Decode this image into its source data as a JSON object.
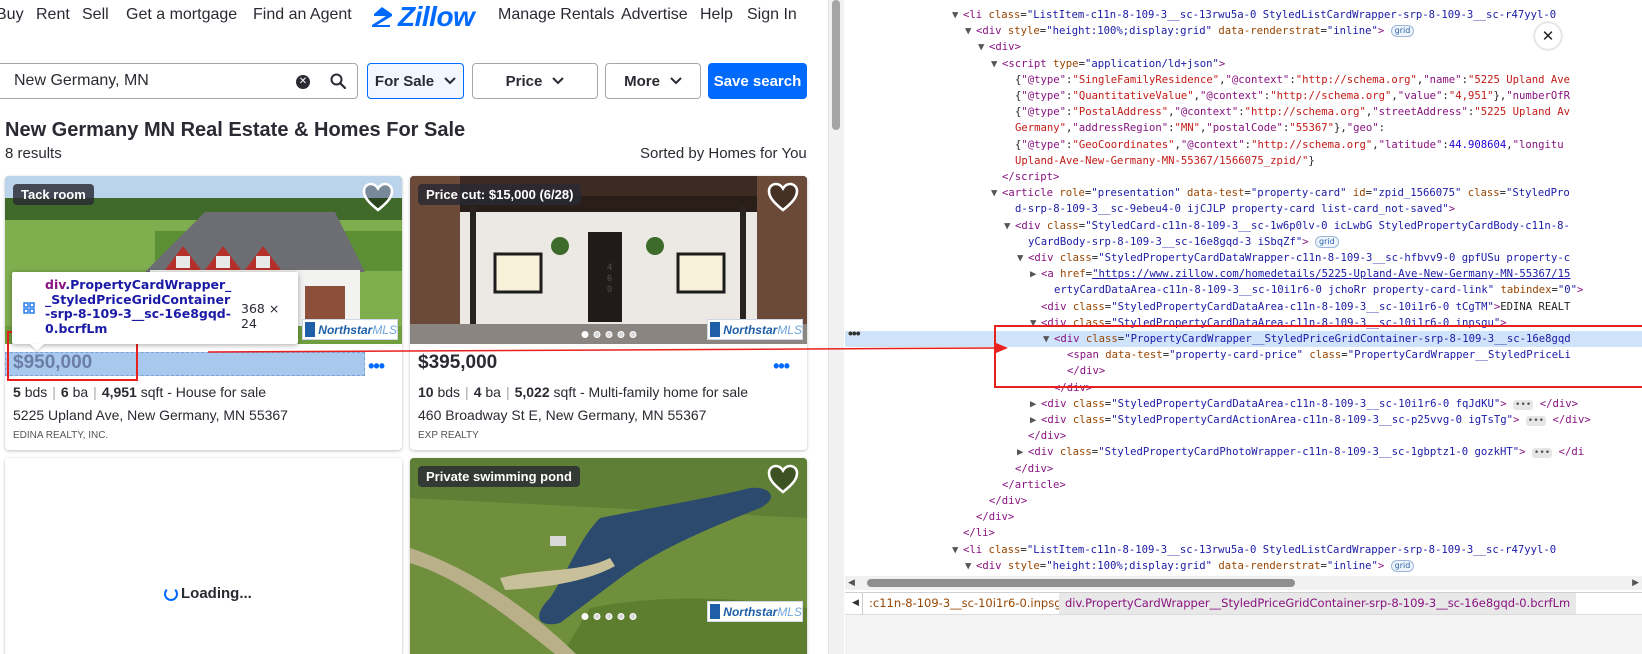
{
  "nav": {
    "buy": "Buy",
    "rent": "Rent",
    "sell": "Sell",
    "mortgage": "Get a mortgage",
    "agent": "Find an Agent",
    "logo_text": "Zillow",
    "manage_rentals": "Manage Rentals",
    "advertise": "Advertise",
    "help": "Help",
    "sign_in": "Sign In"
  },
  "search": {
    "value": "New Germany, MN",
    "clear_glyph": "✕"
  },
  "filters": {
    "for_sale": "For Sale",
    "price": "Price",
    "more": "More",
    "save_search": "Save search"
  },
  "heading": "New Germany MN Real Estate & Homes For Sale",
  "results_count": "8 results",
  "sorted_by": "Sorted by Homes for You",
  "listings": [
    {
      "tag": "Tack room",
      "price": "$950,000",
      "beds": "5",
      "beds_label": "bds",
      "baths": "6",
      "baths_label": "ba",
      "sqft": "4,951",
      "sqft_label": "sqft - House for sale",
      "address": "5225 Upland Ave, New Germany, MN 55367",
      "broker": "EDINA REALTY, INC."
    },
    {
      "tag": "Price cut: $15,000 (6/28)",
      "price": "$395,000",
      "beds": "10",
      "beds_label": "bds",
      "baths": "4",
      "baths_label": "ba",
      "sqft": "5,022",
      "sqft_label": "sqft - Multi-family home for sale",
      "address": "460 Broadway St E, New Germany, MN 55367",
      "broker": "EXP REALTY",
      "house_number": "460"
    },
    {
      "tag": "Private swimming pond"
    }
  ],
  "mls_logo": {
    "brand": "Northstar",
    "suffix": "MLS",
    "tagline": "Information for your Success"
  },
  "loading": "Loading...",
  "more_glyph": "•••",
  "tooltip": {
    "tag": "div",
    "name": ".PropertyCardWrapper__StyledPriceGridContainer-srp-8-109-3__sc-16e8gqd-0.bcrfLm",
    "size": "368 × 24"
  },
  "devtools": {
    "lines": [
      {
        "indent": 0,
        "tri": "▼",
        "html": "<span class=\"tg\">&lt;li</span> <span class=\"at\">class</span>=<span class=\"av\">\"ListItem-c11n-8-109-3__sc-13rwu5a-0 StyledListCardWrapper-srp-8-109-3__sc-r47yyl-0</span>"
      },
      {
        "indent": 1,
        "tri": "▼",
        "html": "<span class=\"tg\">&lt;div</span> <span class=\"at\">style</span>=<span class=\"av\">\"height:100%;display:grid\"</span> <span class=\"at\">data-renderstrat</span>=<span class=\"av\">\"inline\"</span><span class=\"tg\">&gt;</span> <span class=\"badge\">grid</span>"
      },
      {
        "indent": 2,
        "tri": "▼",
        "html": "<span class=\"tg\">&lt;div&gt;</span>"
      },
      {
        "indent": 3,
        "tri": "▼",
        "html": "<span class=\"tg\">&lt;script</span> <span class=\"at\">type</span>=<span class=\"av\">\"application/ld+json\"</span><span class=\"tg\">&gt;</span>"
      },
      {
        "indent": 4,
        "tri": "",
        "html": "{<span class=\"js-k\">\"@type\"</span>:<span class=\"js-s\">\"SingleFamilyResidence\"</span>,<span class=\"js-k\">\"@context\"</span>:<span class=\"js-s\">\"http://schema.org\"</span>,<span class=\"js-k\">\"name\"</span>:<span class=\"js-s\">\"5225 Upland Ave</span>"
      },
      {
        "indent": 4,
        "tri": "",
        "html": "{<span class=\"js-k\">\"@type\"</span>:<span class=\"js-s\">\"QuantitativeValue\"</span>,<span class=\"js-k\">\"@context\"</span>:<span class=\"js-s\">\"http://schema.org\"</span>,<span class=\"js-k\">\"value\"</span>:<span class=\"js-s\">\"4,951\"</span>},<span class=\"js-k\">\"numberOfR</span>"
      },
      {
        "indent": 4,
        "tri": "",
        "html": "{<span class=\"js-k\">\"@type\"</span>:<span class=\"js-s\">\"PostalAddress\"</span>,<span class=\"js-k\">\"@context\"</span>:<span class=\"js-s\">\"http://schema.org\"</span>,<span class=\"js-k\">\"streetAddress\"</span>:<span class=\"js-s\">\"5225 Upland Av</span>"
      },
      {
        "indent": 4,
        "tri": "",
        "html": "<span class=\"js-s\">Germany\"</span>,<span class=\"js-k\">\"addressRegion\"</span>:<span class=\"js-s\">\"MN\"</span>,<span class=\"js-k\">\"postalCode\"</span>:<span class=\"js-s\">\"55367\"</span>},<span class=\"js-k\">\"geo\"</span>:"
      },
      {
        "indent": 4,
        "tri": "",
        "html": "{<span class=\"js-k\">\"@type\"</span>:<span class=\"js-s\">\"GeoCoordinates\"</span>,<span class=\"js-k\">\"@context\"</span>:<span class=\"js-s\">\"http://schema.org\"</span>,<span class=\"js-k\">\"latitude\"</span>:<span class=\"js-n\">44.908604</span>,<span class=\"js-k\">\"longitu</span>"
      },
      {
        "indent": 4,
        "tri": "",
        "html": "<span class=\"js-s\">Upland-Ave-New-Germany-MN-55367/1566075_zpid/\"</span>}"
      },
      {
        "indent": 3,
        "tri": "",
        "html": "<span class=\"tg\">&lt;/script&gt;</span>"
      },
      {
        "indent": 3,
        "tri": "▼",
        "html": "<span class=\"tg\">&lt;article</span> <span class=\"at\">role</span>=<span class=\"av\">\"presentation\"</span> <span class=\"at\">data-test</span>=<span class=\"av\">\"property-card\"</span> <span class=\"at\">id</span>=<span class=\"av\">\"zpid_1566075\"</span> <span class=\"at\">class</span>=<span class=\"av\">\"StyledPro</span>"
      },
      {
        "indent": 4,
        "tri": "",
        "html": "<span class=\"av\">d-srp-8-109-3__sc-9ebeu4-0 ijCJLP property-card list-card_not-saved\"</span><span class=\"tg\">&gt;</span>"
      },
      {
        "indent": 4,
        "tri": "▼",
        "html": "<span class=\"tg\">&lt;div</span> <span class=\"at\">class</span>=<span class=\"av\">\"StyledCard-c11n-8-109-3__sc-1w6p0lv-0 icLwbG StyledPropertyCardBody-c11n-8-</span>"
      },
      {
        "indent": 5,
        "tri": "",
        "html": "<span class=\"av\">yCardBody-srp-8-109-3__sc-16e8gqd-3 iSbqZf\"</span><span class=\"tg\">&gt;</span> <span class=\"badge\">grid</span>"
      },
      {
        "indent": 5,
        "tri": "▼",
        "html": "<span class=\"tg\">&lt;div</span> <span class=\"at\">class</span>=<span class=\"av\">\"StyledPropertyCardDataWrapper-c11n-8-109-3__sc-hfbvv9-0 gpfUSu property-c</span>"
      },
      {
        "indent": 6,
        "tri": "▶",
        "html": "<span class=\"tg\">&lt;a</span> <span class=\"at\">href</span>=<span class=\"lk\">\"https://www.zillow.com/homedetails/5225-Upland-Ave-New-Germany-MN-55367/15</span>"
      },
      {
        "indent": 7,
        "tri": "",
        "html": "<span class=\"av\">ertyCardDataArea-c11n-8-109-3__sc-10i1r6-0 jchoRr property-card-link\"</span> <span class=\"at\">tabindex</span>=<span class=\"av\">\"0\"</span><span class=\"tg\">&gt;</span>"
      },
      {
        "indent": 6,
        "tri": "",
        "html": "<span class=\"tg\">&lt;div</span> <span class=\"at\">class</span>=<span class=\"av\">\"StyledPropertyCardDataArea-c11n-8-109-3__sc-10i1r6-0 tCgTM\"</span><span class=\"tg\">&gt;</span>EDINA REALT"
      },
      {
        "indent": 6,
        "tri": "▼",
        "html": "<span class=\"tg\">&lt;div</span> <span class=\"at\">class</span>=<span class=\"av\">\"StyledPropertyCardDataArea-c11n-8-109-3__sc-10i1r6-0 inpsgu\"</span><span class=\"tg\">&gt;</span>"
      },
      {
        "indent": 7,
        "tri": "▼",
        "sel": true,
        "html": "<span class=\"tg\">&lt;div</span> <span class=\"at\">class</span>=<span class=\"av\">\"PropertyCardWrapper__StyledPriceGridContainer-srp-8-109-3__sc-16e8gqd</span>"
      },
      {
        "indent": 8,
        "tri": "",
        "html": "<span class=\"tg\">&lt;span</span> <span class=\"at\">data-test</span>=<span class=\"av\">\"property-card-price\"</span> <span class=\"at\">class</span>=<span class=\"av\">\"PropertyCardWrapper__StyledPriceLi</span>"
      },
      {
        "indent": 8,
        "tri": "",
        "html": "<span class=\"tg\">&lt;/div&gt;</span>"
      },
      {
        "indent": 7,
        "tri": "",
        "html": "<span class=\"tg\">&lt;/div&gt;</span>"
      },
      {
        "indent": 6,
        "tri": "▶",
        "html": "<span class=\"tg\">&lt;div</span> <span class=\"at\">class</span>=<span class=\"av\">\"StyledPropertyCardDataArea-c11n-8-109-3__sc-10i1r6-0 fqJdKU\"</span><span class=\"tg\">&gt;</span> <span class=\"ell\">•••</span> <span class=\"tg\">&lt;/div&gt;</span>"
      },
      {
        "indent": 6,
        "tri": "▶",
        "html": "<span class=\"tg\">&lt;div</span> <span class=\"at\">class</span>=<span class=\"av\">\"StyledPropertyCardActionArea-c11n-8-109-3__sc-p25vvg-0 igTsTg\"</span><span class=\"tg\">&gt;</span> <span class=\"ell\">•••</span> <span class=\"tg\">&lt;/div&gt;</span>"
      },
      {
        "indent": 5,
        "tri": "",
        "html": "<span class=\"tg\">&lt;/div&gt;</span>"
      },
      {
        "indent": 5,
        "tri": "▶",
        "html": "<span class=\"tg\">&lt;div</span> <span class=\"at\">class</span>=<span class=\"av\">\"StyledPropertyCardPhotoWrapper-c11n-8-109-3__sc-1gbptz1-0 gozkHT\"</span><span class=\"tg\">&gt;</span> <span class=\"ell\">•••</span> <span class=\"tg\">&lt;/di</span>"
      },
      {
        "indent": 4,
        "tri": "",
        "html": "<span class=\"tg\">&lt;/div&gt;</span>"
      },
      {
        "indent": 3,
        "tri": "",
        "html": "<span class=\"tg\">&lt;/article&gt;</span>"
      },
      {
        "indent": 2,
        "tri": "",
        "html": "<span class=\"tg\">&lt;/div&gt;</span>"
      },
      {
        "indent": 1,
        "tri": "",
        "html": "<span class=\"tg\">&lt;/div&gt;</span>"
      },
      {
        "indent": 0,
        "tri": "",
        "html": "<span class=\"tg\">&lt;/li&gt;</span>"
      },
      {
        "indent": 0,
        "tri": "▼",
        "html": "<span class=\"tg\">&lt;li</span> <span class=\"at\">class</span>=<span class=\"av\">\"ListItem-c11n-8-109-3__sc-13rwu5a-0 StyledListCardWrapper-srp-8-109-3__sc-r47yyl-0</span>"
      },
      {
        "indent": 1,
        "tri": "▼",
        "html": "<span class=\"tg\">&lt;div</span> <span class=\"at\">style</span>=<span class=\"av\">\"height:100%;display:grid\"</span> <span class=\"at\">data-renderstrat</span>=<span class=\"av\">\"inline\"</span><span class=\"tg\">&gt;</span> <span class=\"badge\">grid</span>"
      }
    ],
    "gutter_dots": "•••",
    "close_glyph": "✕",
    "breadcrumbs": {
      "back_glyph": "◀",
      "first": ":c11n-8-109-3__sc-10i1r6-0.inpsgu",
      "second": "div.PropertyCardWrapper__StyledPriceGridContainer-srp-8-109-3__sc-16e8gqd-0.bcrfLm"
    },
    "hscroll": {
      "left_glyph": "◀",
      "right_glyph": "▶"
    }
  }
}
